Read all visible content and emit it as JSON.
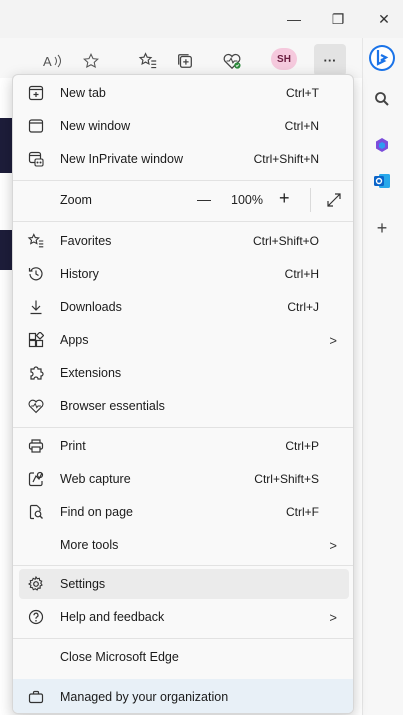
{
  "window": {
    "minimize_glyph": "—",
    "restore_glyph": "❐",
    "close_glyph": "✕"
  },
  "toolbar": {
    "profile_initials": "SH",
    "more_glyph": "···",
    "icons": [
      "read-aloud-icon",
      "star-icon",
      "favorites-icon",
      "collections-icon",
      "browser-essentials-icon",
      "profile-icon",
      "more-icon"
    ]
  },
  "sidebar": {
    "icons": [
      "bing-icon",
      "search-icon",
      "copilot-icon",
      "outlook-icon",
      "add-icon"
    ],
    "add_glyph": "+"
  },
  "menu": {
    "new_tab": {
      "label": "New tab",
      "shortcut": "Ctrl+T"
    },
    "new_window": {
      "label": "New window",
      "shortcut": "Ctrl+N"
    },
    "new_inprivate": {
      "label": "New InPrivate window",
      "shortcut": "Ctrl+Shift+N"
    },
    "zoom": {
      "label": "Zoom",
      "minus": "—",
      "value": "100%",
      "plus": "+"
    },
    "favorites": {
      "label": "Favorites",
      "shortcut": "Ctrl+Shift+O"
    },
    "history": {
      "label": "History",
      "shortcut": "Ctrl+H"
    },
    "downloads": {
      "label": "Downloads",
      "shortcut": "Ctrl+J"
    },
    "apps": {
      "label": "Apps",
      "arrow": ">"
    },
    "extensions": {
      "label": "Extensions"
    },
    "browser_essentials": {
      "label": "Browser essentials"
    },
    "print": {
      "label": "Print",
      "shortcut": "Ctrl+P"
    },
    "web_capture": {
      "label": "Web capture",
      "shortcut": "Ctrl+Shift+S"
    },
    "find_on_page": {
      "label": "Find on page",
      "shortcut": "Ctrl+F"
    },
    "more_tools": {
      "label": "More tools",
      "arrow": ">"
    },
    "settings": {
      "label": "Settings"
    },
    "help_feedback": {
      "label": "Help and feedback",
      "arrow": ">"
    },
    "close_edge": {
      "label": "Close Microsoft Edge"
    },
    "managed": {
      "label": "Managed by your organization"
    }
  }
}
